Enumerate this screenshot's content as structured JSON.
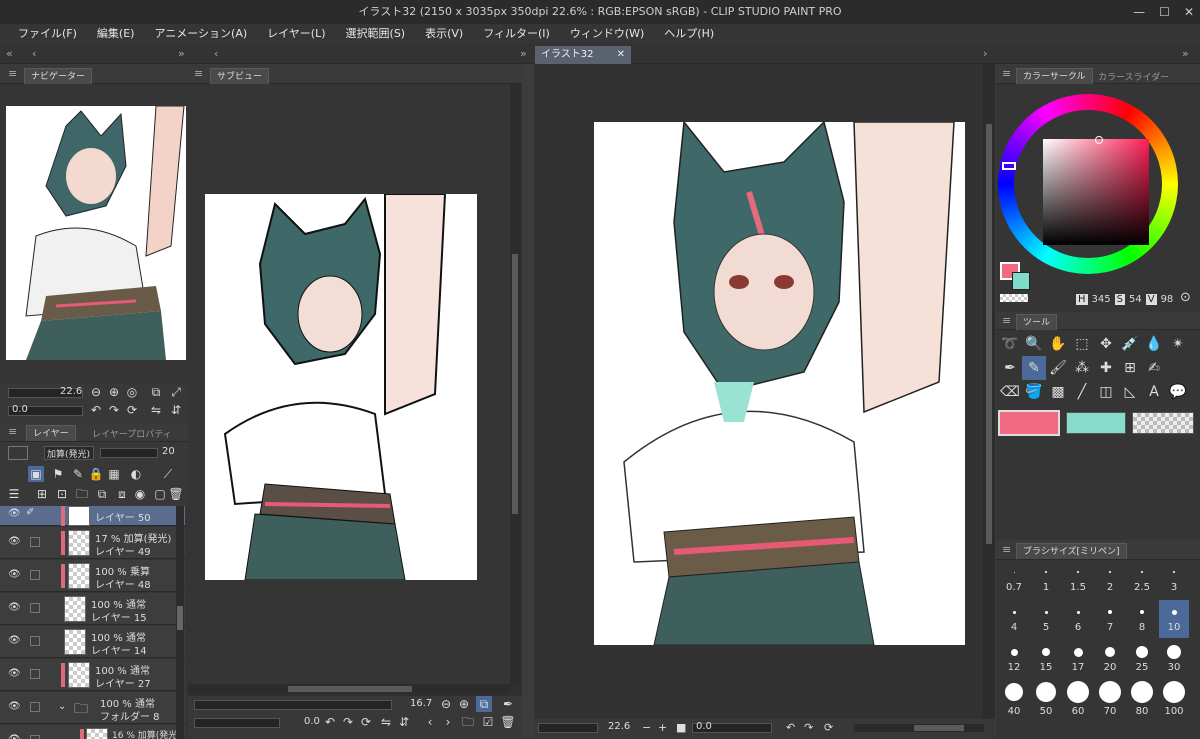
{
  "title": "イラスト32 (2150 x 3035px 350dpi 22.6% : RGB:EPSON sRGB) - CLIP STUDIO PAINT PRO",
  "menu": [
    "ファイル(F)",
    "編集(E)",
    "アニメーション(A)",
    "レイヤー(L)",
    "選択範囲(S)",
    "表示(V)",
    "フィルター(I)",
    "ウィンドウ(W)",
    "ヘルプ(H)"
  ],
  "navigator": {
    "tab": "ナビゲーター",
    "zoom": "22.6",
    "rotate": "0.0"
  },
  "subview": {
    "tab": "サブビュー",
    "zoom": "16.7"
  },
  "canvas": {
    "tab": "イラスト32",
    "zoom": "22.6",
    "rotate": "0.0"
  },
  "layers_panel": {
    "tab": "レイヤー",
    "tab2": "レイヤープロパティ",
    "blend": "加算(発光)",
    "opacity": "20",
    "layers": [
      {
        "line1": "",
        "line2": "レイヤー 50",
        "selected": true
      },
      {
        "line1": "17 % 加算(発光)",
        "line2": "レイヤー 49"
      },
      {
        "line1": "100 % 乗算",
        "line2": "レイヤー 48"
      },
      {
        "line1": "100 % 通常",
        "line2": "レイヤー 15"
      },
      {
        "line1": "100 % 通常",
        "line2": "レイヤー 14"
      },
      {
        "line1": "100 % 通常",
        "line2": "レイヤー 27"
      },
      {
        "line1": "100 % 通常",
        "line2": "フォルダー 8"
      },
      {
        "line1": "16 % 加算(発光)",
        "line2": ""
      }
    ]
  },
  "color_panel": {
    "tab": "カラーサークル",
    "tab2": "カラースライダー",
    "h_label": "H",
    "h": "345",
    "s_label": "S",
    "s": "54",
    "v_label": "V",
    "v": "98",
    "main_color": "#f06a82",
    "sub_color": "#7fdcc8"
  },
  "tool_panel": {
    "tab": "ツール",
    "swatches": [
      "#f06a82",
      "#86dcc9"
    ]
  },
  "brush_panel": {
    "tab": "ブラシサイズ[ミリペン]",
    "sizes": [
      "0.7",
      "1",
      "1.5",
      "2",
      "2.5",
      "3",
      "4",
      "5",
      "6",
      "7",
      "8",
      "10",
      "12",
      "15",
      "17",
      "20",
      "25",
      "30",
      "40",
      "50",
      "60",
      "70",
      "80",
      "100"
    ]
  }
}
